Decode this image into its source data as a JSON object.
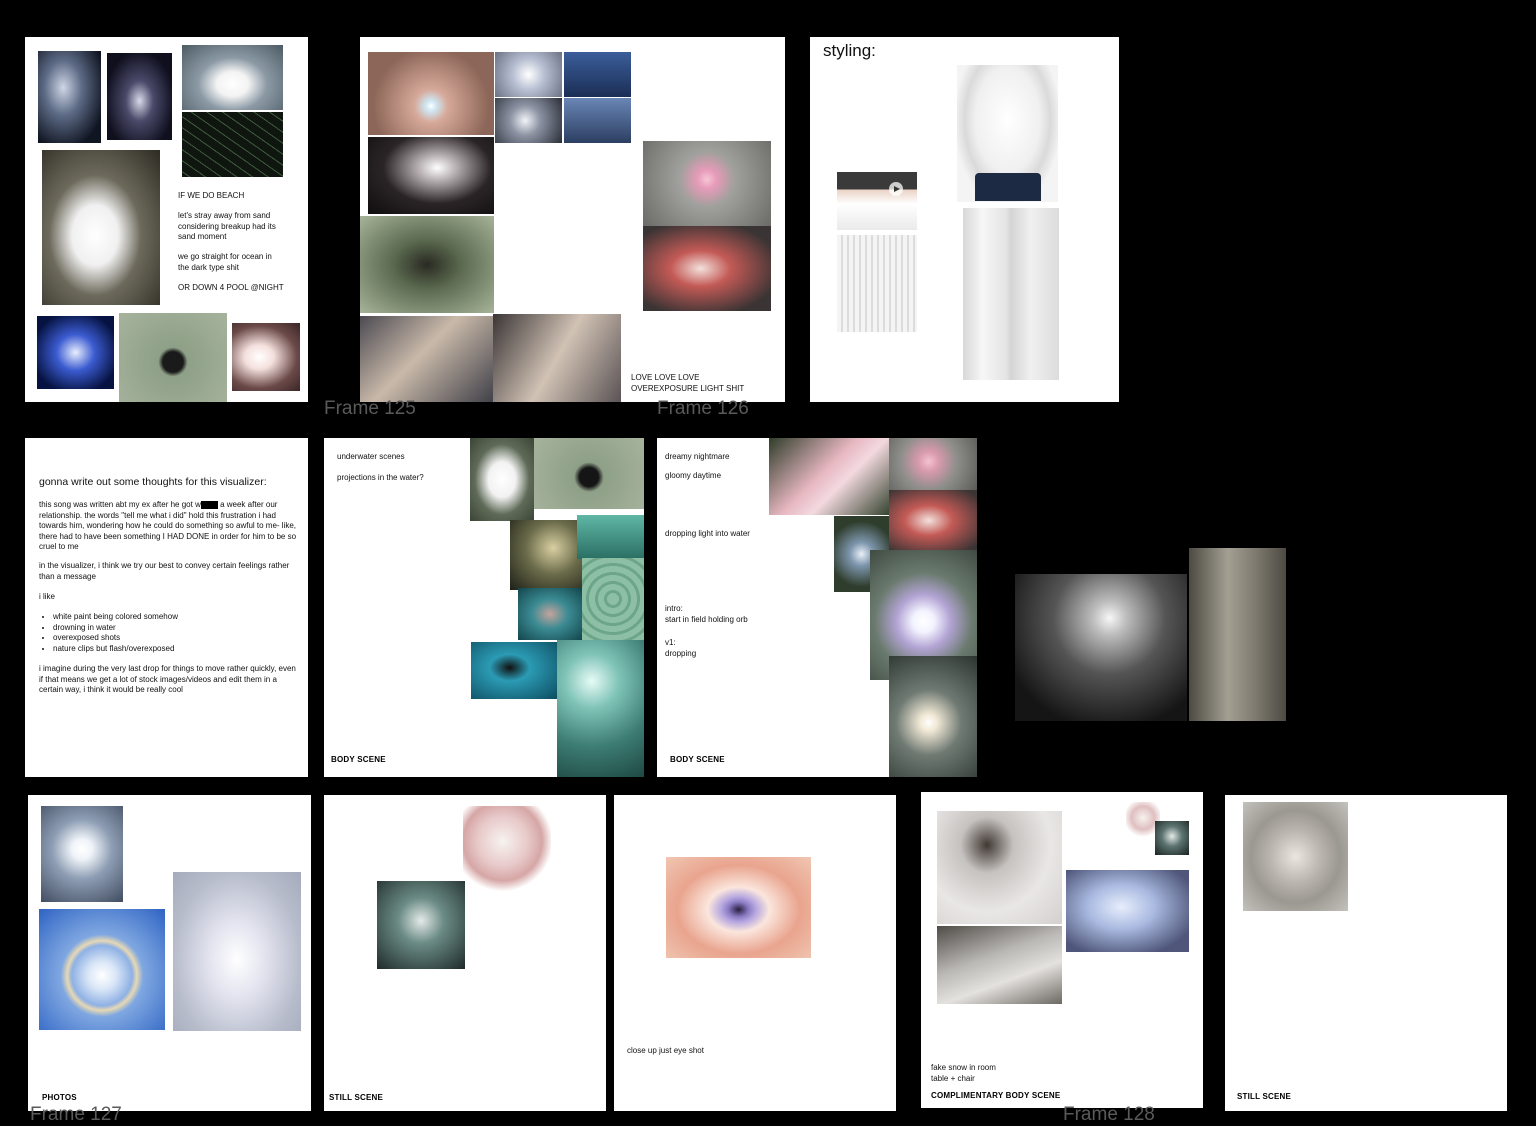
{
  "frames": {
    "beach": {
      "heading": "IF WE DO BEACH",
      "para1": "let's stray away from sand\nconsidering breakup had its\nsand moment",
      "para2": "we go straight for ocean in\nthe dark type shit",
      "para3": "OR DOWN 4 POOL @NIGHT"
    },
    "overexposure": {
      "caption": "LOVE LOVE LOVE\nOVEREXPOSURE LIGHT SHIT"
    },
    "styling": {
      "title": "styling:"
    },
    "thoughts": {
      "title": "gonna write out some thoughts for this visualizer:",
      "p1a": "this song was written abt my ex after he got w",
      "p1b": " a week after our relationship. the words \"tell me what i did\" hold this frustration i had towards him, wondering how he could do something so awful to me- like, there had to have been something I HAD DONE in order for him to be so cruel to me",
      "p2": "in the visualizer, i think we try our best to convey certain feelings rather than a message",
      "p3": "i like",
      "likes": [
        "white paint being colored somehow",
        "drowning in water",
        "overexposed shots",
        "nature clips but flash/overexposed"
      ],
      "p4": "i imagine during the very last drop for things to move rather quickly, even if that means we get a lot of stock images/videos and edit them in a certain way, i think it would be really cool"
    },
    "underwater": {
      "line1": "underwater scenes",
      "line2": "projections in the water?",
      "label": "BODY SCENE"
    },
    "dreamy": {
      "line1": "dreamy nightmare",
      "line2": "gloomy daytime",
      "line3": "dropping light into water",
      "line4": "intro:\nstart in field holding orb",
      "line5": "v1:\ndropping",
      "label": "BODY SCENE"
    },
    "photos": {
      "label": "PHOTOS"
    },
    "still1": {
      "label": "STILL SCENE"
    },
    "eye": {
      "caption": "close up just eye shot"
    },
    "snow": {
      "caption": "fake snow in room\ntable + chair",
      "label": "COMPLIMENTARY BODY SCENE"
    },
    "still2": {
      "label": "STILL SCENE"
    }
  },
  "frame_titles": {
    "f125": "Frame 125",
    "f126": "Frame 126",
    "f127": "Frame 127",
    "f128": "Frame 128"
  }
}
